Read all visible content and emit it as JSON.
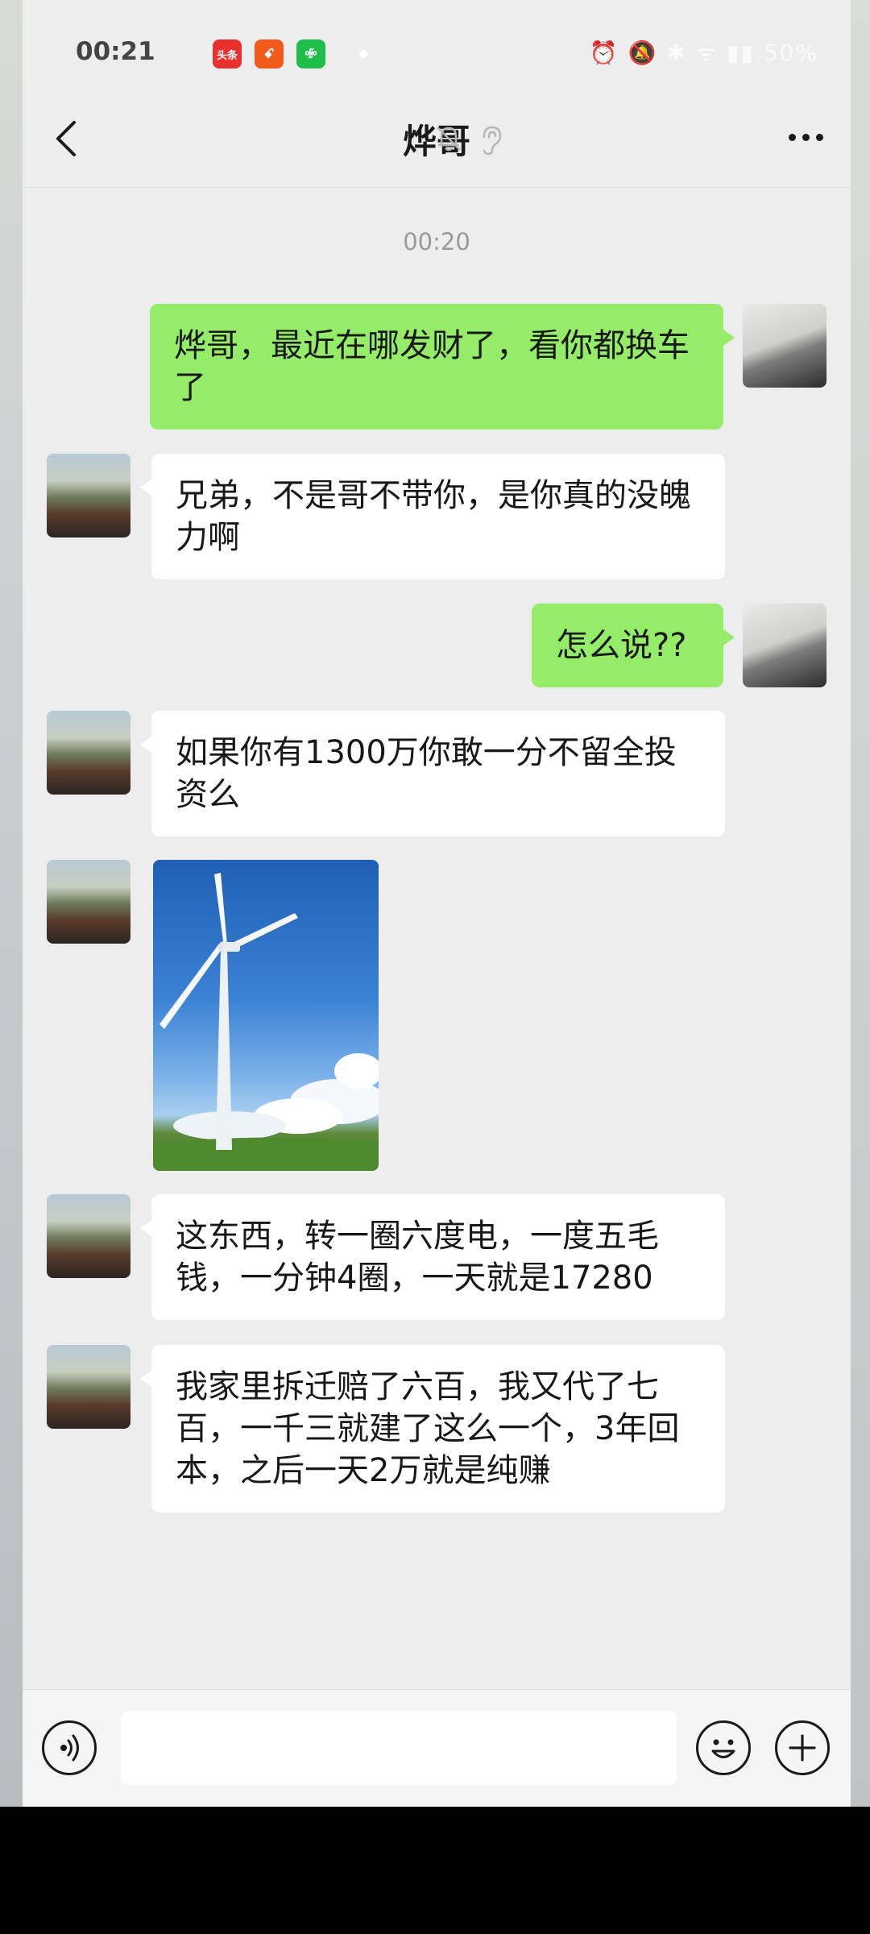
{
  "status_bar": {
    "time": "00:21",
    "app_icons": [
      {
        "label": "头条",
        "color": "#e8312f"
      },
      {
        "label": "ꗃ",
        "color": "#f25a1c"
      },
      {
        "label": "ꗂ",
        "color": "#1fbd4a"
      }
    ],
    "right_indicators": "⏰ 🔕 ✱ ᯤ ▮▮ 50%"
  },
  "header": {
    "title": "烨哥",
    "back_icon": "chevron-left-icon",
    "mute_icon": "bell-muted-icon",
    "earpiece_icon": "ear-icon",
    "more_icon": "more-dots-icon"
  },
  "chat": {
    "timestamp": "00:20",
    "messages": [
      {
        "from": "me",
        "text": "烨哥，最近在哪发财了，看你都换车了"
      },
      {
        "from": "friend",
        "text": "兄弟，不是哥不带你，是你真的没魄力啊"
      },
      {
        "from": "me",
        "text": "怎么说??"
      },
      {
        "from": "friend",
        "text": "如果你有1300万你敢一分不留全投资么"
      },
      {
        "from": "friend",
        "type": "image",
        "description": "wind-turbine-photo"
      },
      {
        "from": "friend",
        "text": "这东西，转一圈六度电，一度五毛钱，一分钟4圈，一天就是17280"
      },
      {
        "from": "friend",
        "text": "我家里拆迁赔了六百，我又代了七百，一千三就建了这么一个，3年回本，之后一天2万就是纯赚"
      }
    ]
  },
  "input_bar": {
    "voice_icon": "voice-icon",
    "emoji_icon": "emoji-icon",
    "plus_icon": "plus-icon"
  },
  "colors": {
    "outgoing_bubble": "#95ec69",
    "incoming_bubble": "#ffffff",
    "chat_background": "#ededed"
  }
}
